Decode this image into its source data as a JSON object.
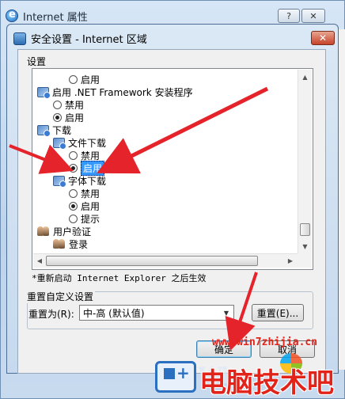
{
  "outer_window": {
    "title": "Internet 属性",
    "help_label": "?",
    "close_label": "✕"
  },
  "dialog": {
    "title": "安全设置 - Internet 区域",
    "close_label": "✕",
    "settings_label": "设置",
    "items": [
      {
        "type": "radio",
        "label": "启用",
        "checked": false
      },
      {
        "type": "category",
        "label": "启用 .NET Framework 安装程序",
        "icon": "settings-category-icon"
      },
      {
        "type": "radio",
        "label": "禁用",
        "checked": false
      },
      {
        "type": "radio",
        "label": "启用",
        "checked": true
      },
      {
        "type": "category",
        "label": "下载",
        "icon": "settings-category-icon"
      },
      {
        "type": "category",
        "label": "文件下载",
        "icon": "settings-category-icon"
      },
      {
        "type": "radio",
        "label": "禁用",
        "checked": false
      },
      {
        "type": "radio",
        "label": "启用",
        "checked": true,
        "selected": true
      },
      {
        "type": "category",
        "label": "字体下载",
        "icon": "settings-category-icon"
      },
      {
        "type": "radio",
        "label": "禁用",
        "checked": false
      },
      {
        "type": "radio",
        "label": "启用",
        "checked": true
      },
      {
        "type": "radio",
        "label": "提示",
        "checked": false
      },
      {
        "type": "category",
        "label": "用户验证",
        "icon": "users-icon"
      },
      {
        "type": "category",
        "label": "登录",
        "icon": "users-icon"
      }
    ],
    "restart_note": "*重新启动 Internet Explorer 之后生效",
    "reset_group_title": "重置自定义设置",
    "reset_to_label": "重置为(R):",
    "reset_select_value": "中-高 (默认值)",
    "reset_button": "重置(E)...",
    "ok_button": "确定",
    "cancel_button": "取消"
  },
  "watermark": {
    "url": "www.win7zhijia.cn",
    "brand": "电脑技术吧",
    "os_text": "Win"
  },
  "colors": {
    "annotation_arrow": "#e5232a",
    "selection": "#3399ff",
    "watermark_red": "#e2231a"
  }
}
